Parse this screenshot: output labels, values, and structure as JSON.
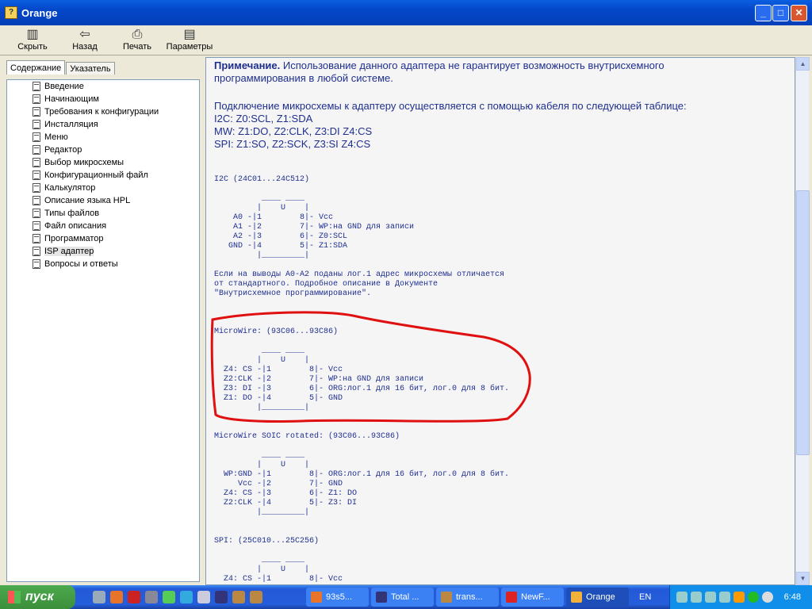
{
  "window": {
    "title": "Orange"
  },
  "toolbar": [
    {
      "label": "Скрыть",
      "icon": "hide-icon"
    },
    {
      "label": "Назад",
      "icon": "back-icon"
    },
    {
      "label": "Печать",
      "icon": "print-icon"
    },
    {
      "label": "Параметры",
      "icon": "options-icon"
    }
  ],
  "tabs": [
    {
      "label": "Содержание"
    },
    {
      "label": "Указатель"
    }
  ],
  "tree": [
    "Введение",
    "Начинающим",
    "Требования к конфигурации",
    "Инсталляция",
    "Меню",
    "Редактор",
    "Выбор микросхемы",
    "Конфигурационный файл",
    "Калькулятор",
    "Описание языка HPL",
    "Типы файлов",
    "Файл описания",
    "Программатор",
    "ISP адаптер",
    "Вопросы и ответы"
  ],
  "content": {
    "note_bold": "Примечание.",
    "note_text": " Использование данного адаптера не гарантирует возможность внутрисхемного\nпрограммирования в любой системе.",
    "connection": "Подключение микросхемы к адаптеру осуществляется с помощью кабеля по следующей таблице:\nI2C: Z0:SCL, Z1:SDA\nMW: Z1:DO, Z2:CLK, Z3:DI Z4:CS\nSPI: Z1:SO, Z2:SCK, Z3:SI Z4:CS",
    "i2c_title": "I2C (24C01...24C512)",
    "i2c_diagram": "          ____ ____\n         |    U    |\n    A0 -|1        8|- Vcc\n    A1 -|2        7|- WP:на GND для записи\n    A2 -|3        6|- Z0:SCL\n   GND -|4        5|- Z1:SDA\n         |_________|",
    "i2c_note": "Если на выводы A0-A2 поданы лог.1 адрес микросхемы отличается\nот стандартного. Подробное описание в Документе\n\"Внутрисхемное программирование\".",
    "mw_title": "MicroWire: (93C06...93C86)",
    "mw_diagram": "          ____ ____\n         |    U    |\n  Z4: CS -|1        8|- Vcc\n  Z2:CLK -|2        7|- WP:на GND для записи\n  Z3: DI -|3        6|- ORG:лог.1 для 16 бит, лог.0 для 8 бит.\n  Z1: DO -|4        5|- GND\n         |_________|",
    "soic_title": "MicroWire SOIC rotated: (93C06...93C86)",
    "soic_diagram": "          ____ ____\n         |    U    |\n  WP:GND -|1        8|- ORG:лог.1 для 16 бит, лог.0 для 8 бит.\n     Vcc -|2        7|- GND\n  Z4: CS -|3        6|- Z1: DO\n  Z2:CLK -|4        5|- Z3: DI\n         |_________|",
    "spi_title": "SPI: (25C010...25C256)",
    "spi_diagram": "          ____ ____\n         |    U    |\n  Z4: CS -|1        8|- Vcc"
  },
  "taskbar": {
    "start": "пуск",
    "tasks": [
      "93s5...",
      "Total ...",
      "trans...",
      "NewF...",
      "Orange"
    ],
    "lang": "EN",
    "clock": "6:48"
  },
  "colors": {
    "text": "#1f2f8f",
    "annotation": "#e01010"
  }
}
